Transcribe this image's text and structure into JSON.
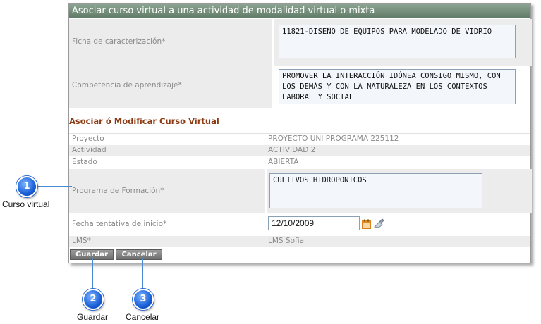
{
  "dialog": {
    "title": "Asociar curso virtual a una actividad de modalidad virtual o mixta"
  },
  "top_fields": {
    "ficha_label": "Ficha de caracterización*",
    "ficha_value": "11821-DISEÑO DE EQUIPOS PARA MODELADO DE VIDRIO",
    "competencia_label": "Competencia de aprendizaje*",
    "competencia_value": "PROMOVER LA INTERACCIÓN IDÓNEA CONSIGO MISMO, CON LOS DEMÁS Y CON LA NATURALEZA EN LOS CONTEXTOS LABORAL Y SOCIAL"
  },
  "section": {
    "title": "Asociar ó Modificar Curso Virtual",
    "proyecto_label": "Proyecto",
    "proyecto_value": "PROYECTO UNI PROGRAMA 225112",
    "actividad_label": "Actividad",
    "actividad_value": "ACTIVIDAD 2",
    "estado_label": "Estado",
    "estado_value": "ABIERTA",
    "programa_label": "Programa de Formación*",
    "programa_value": "CULTIVOS HIDROPONICOS",
    "fecha_label": "Fecha tentativa de inicio*",
    "fecha_value": "12/10/2009",
    "lms_label": "LMS*",
    "lms_value": "LMS Sofia"
  },
  "buttons": {
    "guardar": "Guardar",
    "cancelar": "Cancelar"
  },
  "callouts": [
    {
      "number": "1",
      "label": "Curso virtual"
    },
    {
      "number": "2",
      "label": "Guardar"
    },
    {
      "number": "3",
      "label": "Cancelar"
    }
  ],
  "colors": {
    "title_bar": "#6f8a76",
    "section_title": "#8b3a12",
    "marker": "#1a5fd8"
  },
  "icons": {
    "calendar": "calendar-icon",
    "clear": "clear-icon"
  }
}
